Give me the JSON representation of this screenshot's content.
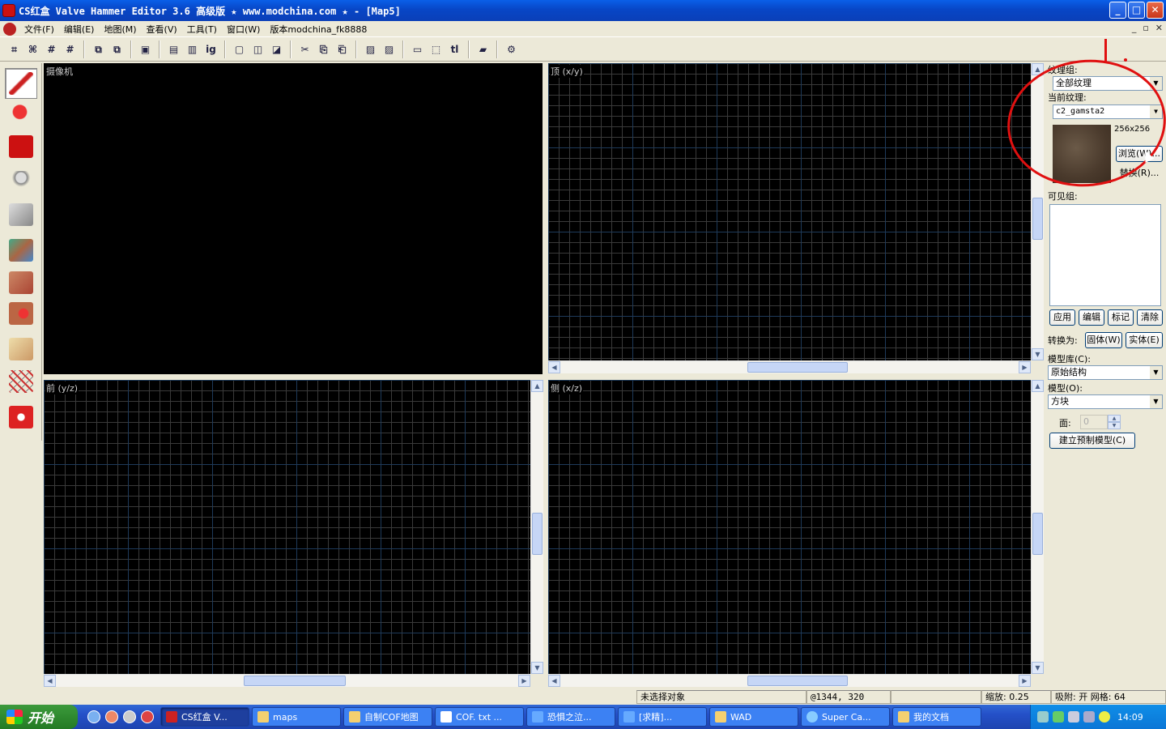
{
  "window": {
    "title": "CS红盒 Valve Hammer Editor 3.6 高级版 ★ www.modchina.com ★ - [Map5]",
    "min_label": "_",
    "max_label": "□",
    "close_label": "✕"
  },
  "menu": {
    "items": [
      "文件(F)",
      "编辑(E)",
      "地图(M)",
      "查看(V)",
      "工具(T)",
      "窗口(W)",
      "版本modchina_fk8888"
    ],
    "mdi_min": "_",
    "mdi_restore": "▫",
    "mdi_close": "✕"
  },
  "toolbar": {
    "groups": [
      [
        "grid-icon",
        "grid-smaller-icon",
        "grid-larger-icon",
        "grid-toggle-icon"
      ],
      [
        "group-icon",
        "ungroup-icon"
      ],
      [
        "carve-icon",
        "hollow-icon",
        "texture-lock-icon",
        "ignore-groups-icon"
      ],
      [
        "brush-icon",
        "brush-copy-icon",
        "brush-3d-icon"
      ],
      [
        "cut-icon",
        "copy-icon",
        "paste-icon"
      ],
      [
        "hide-icon",
        "hide-selected-icon"
      ],
      [
        "select-box-icon",
        "select-object-icon",
        "tie-icon"
      ],
      [
        "run-map-icon"
      ],
      [
        "options-icon"
      ]
    ],
    "glyphs": [
      "⌗",
      "⌘",
      "#",
      "#",
      "⧉",
      "⧉",
      "▣",
      "▤",
      "▥",
      "ig",
      "▢",
      "◫",
      "◪",
      "✂",
      "⎘",
      "⎗",
      "▨",
      "▨",
      "▭",
      "⬚",
      "tl",
      "▰",
      "⚙"
    ]
  },
  "left_tools": [
    "selection-tool-icon",
    "magnify-tool-icon",
    "camera-tool-icon",
    "entity-tool-icon",
    "block-tool-icon",
    "texture-tool-icon",
    "apply-texture-icon",
    "decal-tool-icon",
    "clipping-tool-icon",
    "vertex-tool-icon",
    "path-tool-icon"
  ],
  "viewports": {
    "camera": "摄像机",
    "top": "顶 (x/y)",
    "front": "前 (y/z)",
    "side": "侧 (x/z)"
  },
  "panel": {
    "texture_group_label": "纹理组:",
    "texture_group_value": "全部纹理",
    "current_texture_label": "当前纹理:",
    "current_texture_value": "c2_gamsta2",
    "texture_size": "256x256",
    "browse_button": "浏览(W)...",
    "replace_button": "替换(R)...",
    "visgroup_label": "可见组:",
    "apply_button": "应用",
    "edit_button": "编辑",
    "mark_button": "标记",
    "purge_button": "清除",
    "convert_label": "转换为:",
    "world_button": "固体(W)",
    "entity_button": "实体(E)",
    "prefab_lib_label": "模型库(C):",
    "prefab_lib_value": "原始结构",
    "object_label": "模型(O):",
    "object_value": "方块",
    "faces_label": "面:",
    "faces_value": "0",
    "create_prefab_button": "建立预制模型(C)"
  },
  "statusbar": {
    "selection": "未选择对象",
    "coords": "@1344, 320",
    "zoom": "缩放: 0.25",
    "snap": "吸附: 开 网格: 64"
  },
  "taskbar": {
    "start_label": "开始",
    "tasks": [
      "CS红盒 V...",
      "maps",
      "自制COF地图",
      "COF. txt ...",
      "恐惧之泣...",
      "[求精]...",
      "WAD",
      "Super Ca...",
      "我的文档"
    ],
    "clock": "14:09"
  },
  "colors": {
    "viewport_bg": "#000000",
    "grid_minor": "#3a3a3a",
    "annotation": "#e01010",
    "title_bar": "#0a5fe8"
  }
}
